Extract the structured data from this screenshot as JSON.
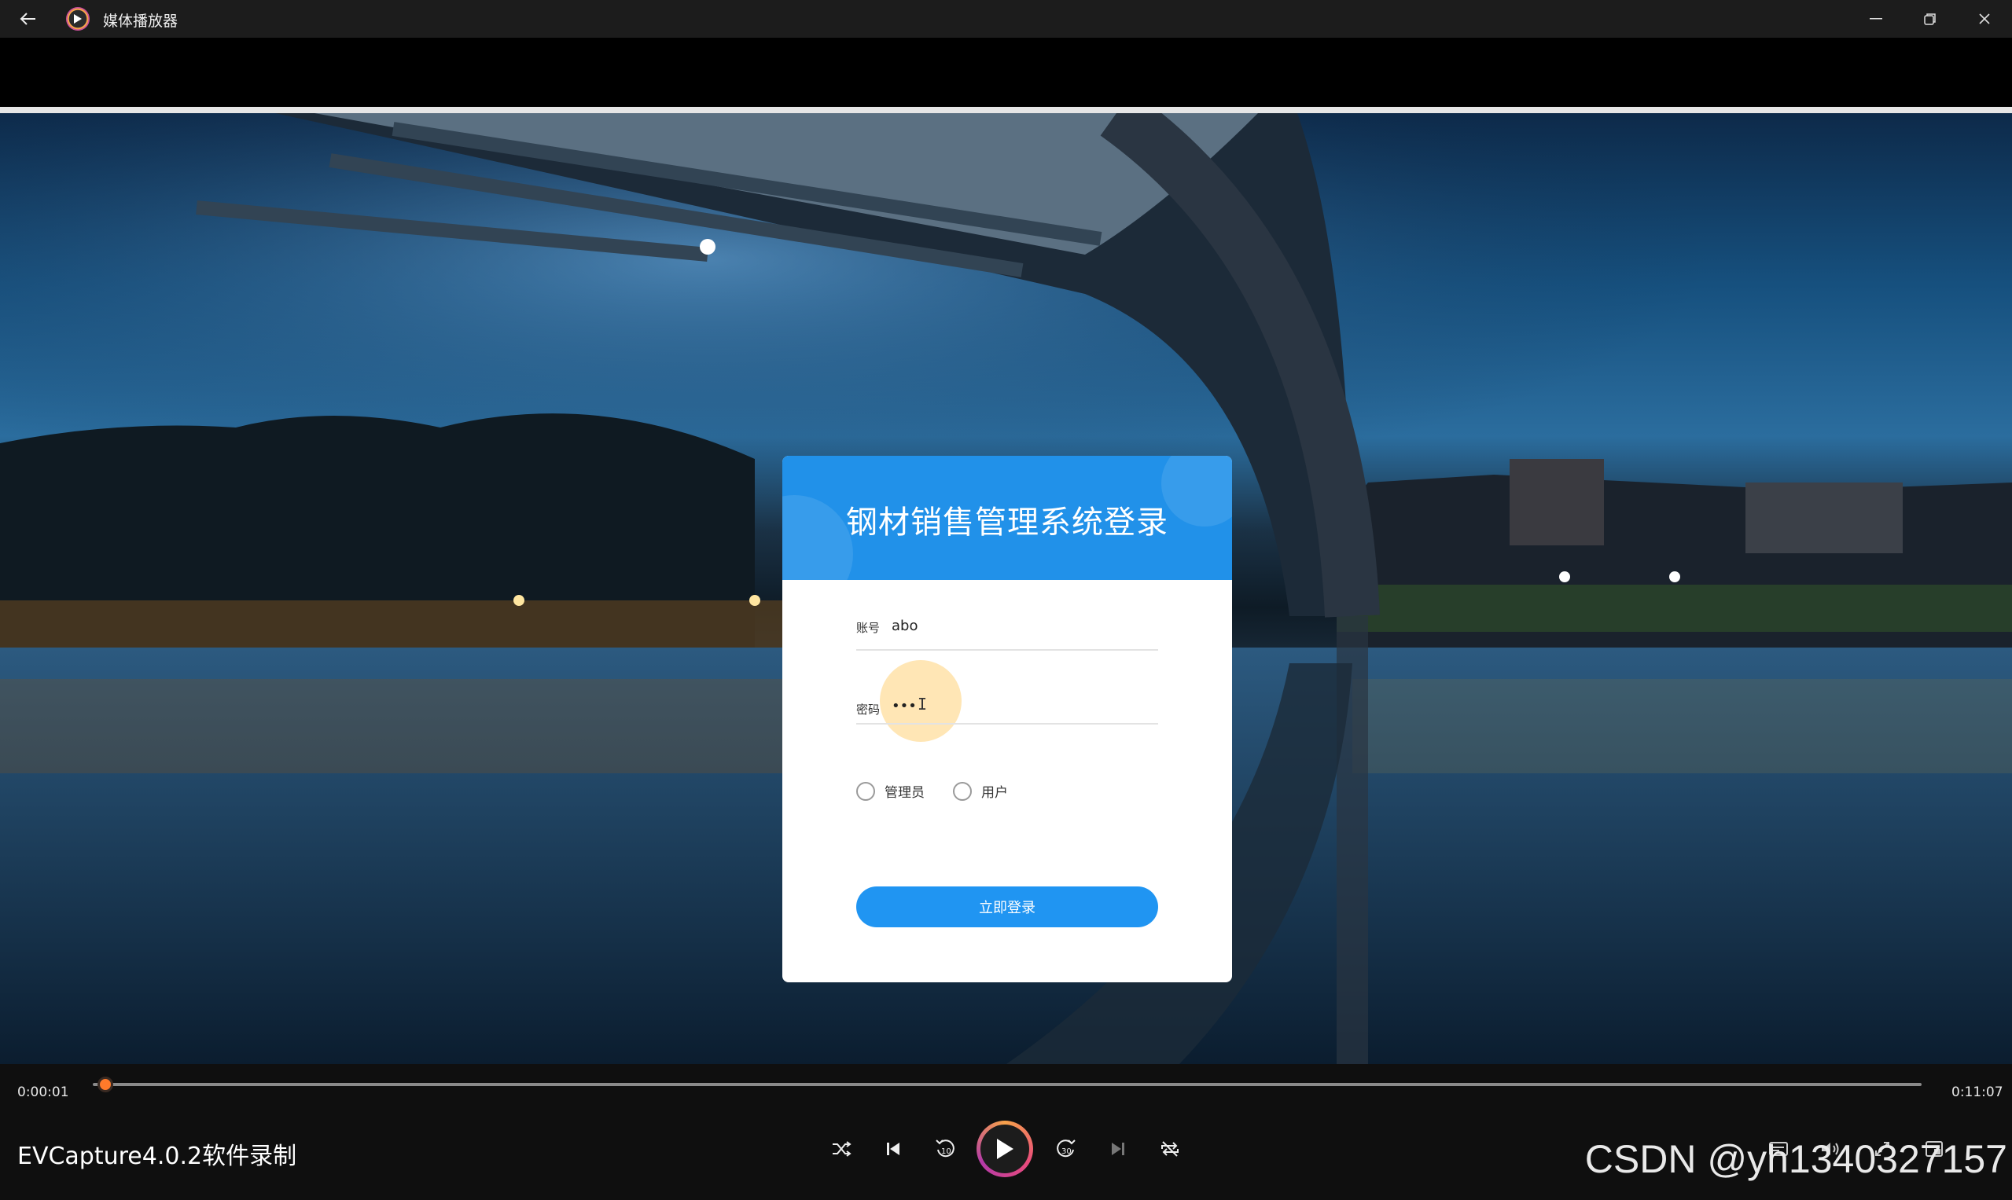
{
  "window": {
    "title": "媒体播放器",
    "back_icon": "back-arrow-icon",
    "app_icon": "media-player-icon",
    "controls": [
      "minimize-icon",
      "restore-icon",
      "close-icon"
    ]
  },
  "login": {
    "title": "钢材销售管理系统登录",
    "account_label": "账号",
    "account_value": "abo",
    "password_label": "密码",
    "password_value": "•••",
    "roles": [
      "管理员",
      "用户"
    ],
    "submit_label": "立即登录"
  },
  "player": {
    "current_time": "0:00:01",
    "total_time": "0:11:07",
    "progress": 0.002,
    "caption": "EVCapture4.0.2软件录制",
    "buttons": [
      "shuffle-icon",
      "previous-icon",
      "rewind-10-icon",
      "play-icon",
      "forward-30-icon",
      "next-icon",
      "repeat-icon",
      "captions-icon",
      "volume-icon",
      "fullscreen-icon",
      "miniplayer-icon"
    ],
    "rewind_label": "10",
    "forward_label": "30"
  },
  "watermark": "CSDN @yh1340327157",
  "colors": {
    "card_header": "#2191e9",
    "login_button": "#2095f2",
    "progress_thumb": "#ff7a2a"
  }
}
